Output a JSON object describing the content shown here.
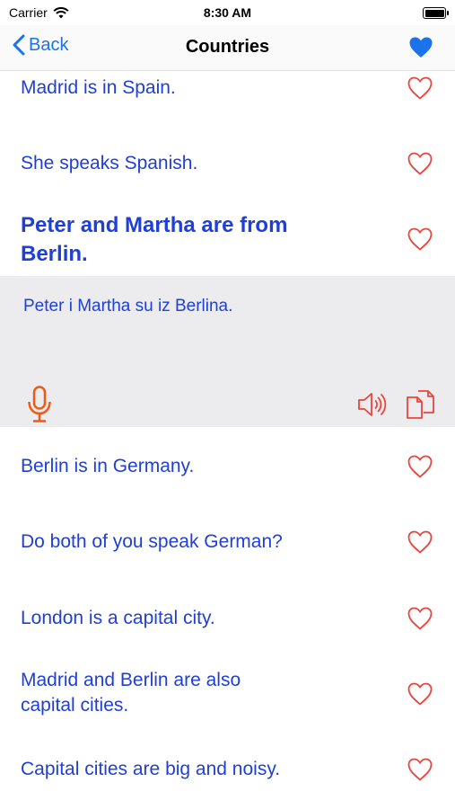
{
  "status_bar": {
    "carrier": "Carrier",
    "time": "8:30 AM",
    "battery_level": 0.9
  },
  "nav": {
    "back_label": "Back",
    "title": "Countries",
    "favorite_icon": "heart-filled-icon"
  },
  "colors": {
    "accent_blue": "#1a73e8",
    "text_blue": "#1f3fd6",
    "heart_red": "#e8453c",
    "mic_orange": "#f05a14",
    "expanded_bg": "#ececee"
  },
  "phrases": [
    {
      "text": "Madrid is in Spain."
    },
    {
      "text": "She speaks Spanish."
    },
    {
      "text": "Peter and Martha are from Berlin."
    },
    {
      "text": "Berlin is in Germany."
    },
    {
      "text": "Do both of you speak German?"
    },
    {
      "text": "London is a capital city."
    },
    {
      "text": "Madrid and Berlin are also capital cities."
    },
    {
      "text": "Capital cities are big and noisy."
    }
  ],
  "expanded": {
    "translation": "Peter i Martha su iz Berlina.",
    "mic_icon": "microphone-icon",
    "speaker_icon": "speaker-icon",
    "copy_icon": "copy-icon"
  }
}
